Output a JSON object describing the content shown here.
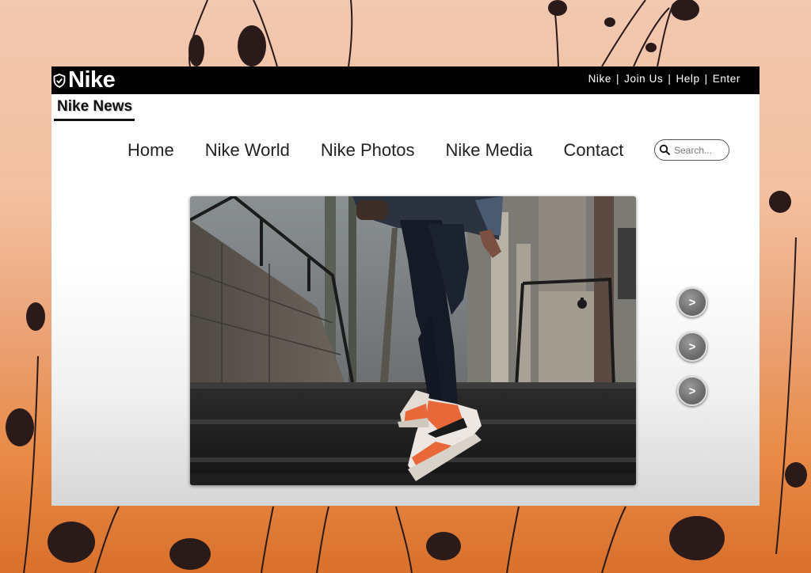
{
  "brand": {
    "logo_text": "Nike",
    "logo_icon": "shield-check-icon"
  },
  "top_links": [
    {
      "label": "Nike"
    },
    {
      "label": "Join Us"
    },
    {
      "label": "Help"
    },
    {
      "label": "Enter"
    }
  ],
  "top_links_separator": "|",
  "section_title": "Nike News",
  "nav": {
    "items": [
      {
        "label": "Home"
      },
      {
        "label": "Nike World"
      },
      {
        "label": "Nike Photos"
      },
      {
        "label": "Nike Media"
      },
      {
        "label": "Contact"
      }
    ]
  },
  "search": {
    "placeholder": "Search...",
    "value": "",
    "icon": "search-icon"
  },
  "slider": {
    "image_subject": "person in jeans wearing orange and white high-top sneakers climbing concrete steps",
    "arrows": [
      {
        "label": ">"
      },
      {
        "label": ">"
      },
      {
        "label": ">"
      }
    ]
  },
  "colors": {
    "topbar": "#000000",
    "panel": "#ffffff",
    "sneaker_accent": "#e8683a",
    "background_sunset": "#e88a45"
  }
}
